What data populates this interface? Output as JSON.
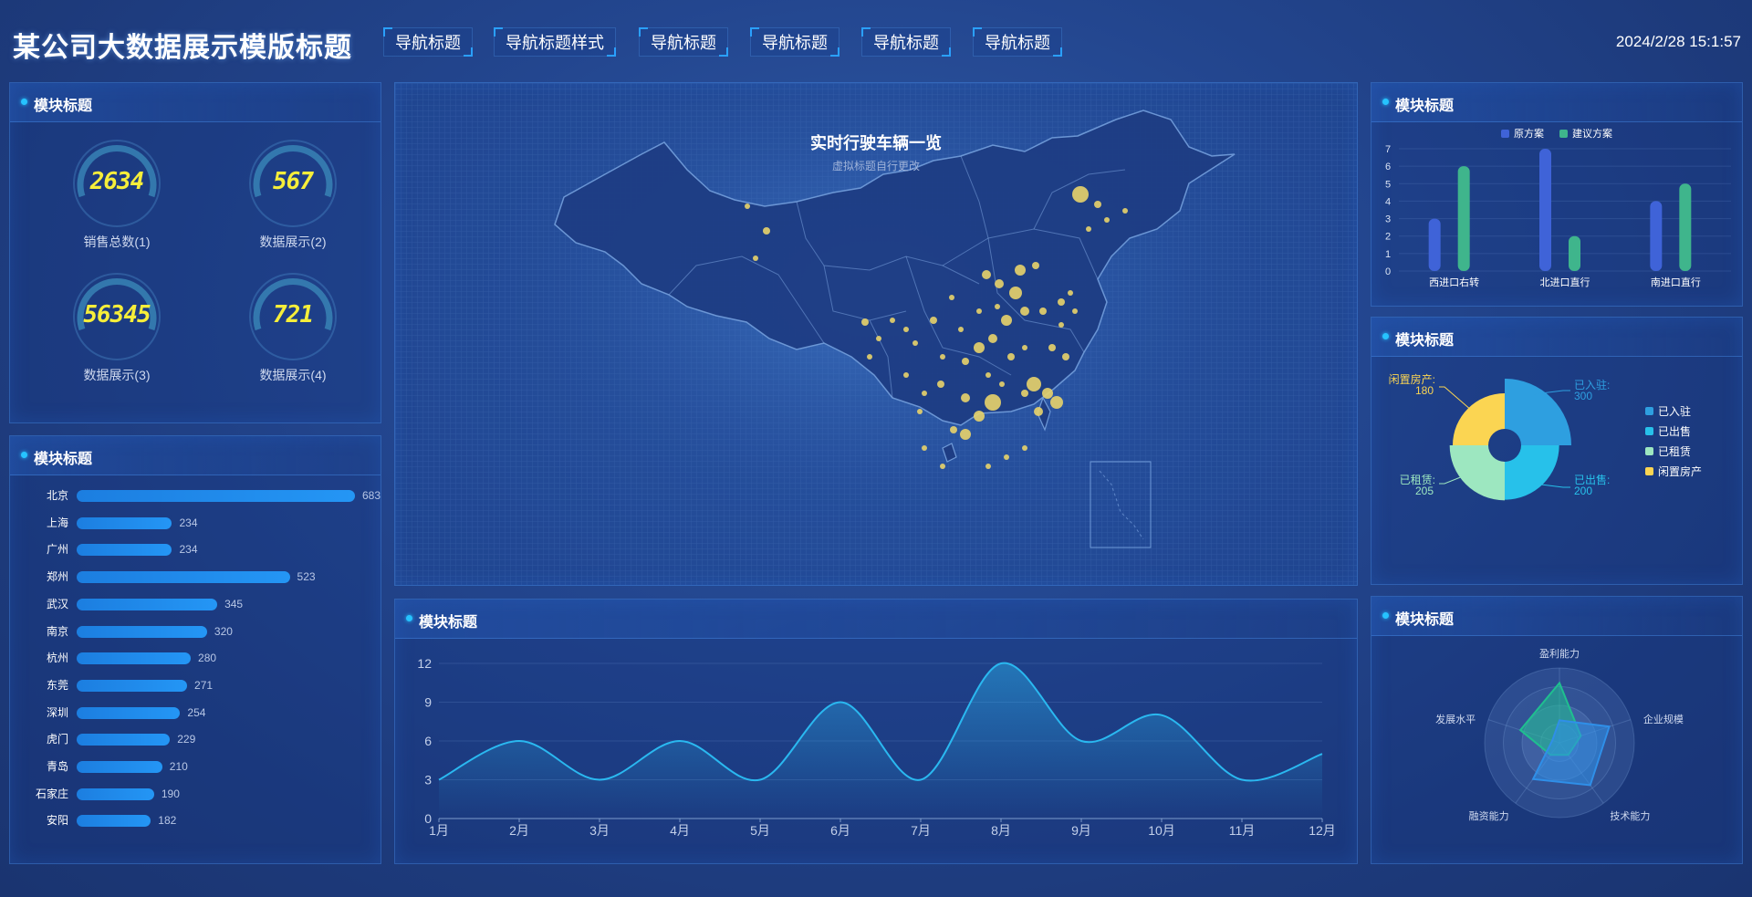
{
  "header": {
    "title": "某公司大数据展示模版标题",
    "nav": [
      "导航标题",
      "导航标题样式",
      "导航标题",
      "导航标题",
      "导航标题",
      "导航标题"
    ],
    "datetime": "2024/2/28 15:1:57"
  },
  "panels": {
    "gauges_title": "模块标题",
    "ranking_title": "模块标题",
    "linechart_title": "模块标题",
    "barchart_title": "模块标题",
    "donut_title": "模块标题",
    "radar_title": "模块标题"
  },
  "gauges": [
    {
      "value": "2634",
      "label": "销售总数(1)"
    },
    {
      "value": "567",
      "label": "数据展示(2)"
    },
    {
      "value": "56345",
      "label": "数据展示(3)"
    },
    {
      "value": "721",
      "label": "数据展示(4)"
    }
  ],
  "map": {
    "title": "实时行驶车辆一览",
    "subtitle": "虚拟标题自行更改"
  },
  "colors": {
    "accent": "#26c3ff",
    "bar_blue": "#1c8ae8",
    "gauge_digit": "#f6ee3a",
    "series_a": "#3f63d8",
    "series_b": "#3fb58c",
    "line": "#2ab8f0",
    "map_dot": "#e8d36a"
  },
  "chart_data": [
    {
      "type": "bar",
      "orientation": "horizontal",
      "categories": [
        "北京",
        "上海",
        "广州",
        "郑州",
        "武汉",
        "南京",
        "杭州",
        "东莞",
        "深圳",
        "虎门",
        "青岛",
        "石家庄",
        "安阳"
      ],
      "values": [
        683,
        234,
        234,
        523,
        345,
        320,
        280,
        271,
        254,
        229,
        210,
        190,
        182
      ]
    },
    {
      "type": "area",
      "categories": [
        "1月",
        "2月",
        "3月",
        "4月",
        "5月",
        "6月",
        "7月",
        "8月",
        "9月",
        "10月",
        "11月",
        "12月"
      ],
      "values": [
        3,
        6,
        3,
        6,
        3,
        9,
        3,
        12,
        6,
        8,
        3,
        5
      ],
      "ylim": [
        0,
        12
      ],
      "yticks": [
        0,
        3,
        6,
        9,
        12
      ]
    },
    {
      "type": "bar",
      "categories": [
        "西进口右转",
        "北进口直行",
        "南进口直行"
      ],
      "series": [
        {
          "name": "原方案",
          "values": [
            3,
            7,
            4
          ]
        },
        {
          "name": "建议方案",
          "values": [
            6,
            2,
            5
          ]
        }
      ],
      "ylim": [
        0,
        7
      ],
      "yticks": [
        0,
        1,
        2,
        3,
        4,
        5,
        6,
        7
      ],
      "legend": "top-center"
    },
    {
      "type": "pie",
      "style": "rose-donut",
      "slices": [
        {
          "name": "已入驻",
          "value": 300,
          "color": "#2e9fe0",
          "label": "已入驻:"
        },
        {
          "name": "已出售",
          "value": 200,
          "color": "#27c1ea",
          "label": "已出售:"
        },
        {
          "name": "已租赁",
          "value": 205,
          "color": "#9de7c0",
          "label": "已租赁:"
        },
        {
          "name": "闲置房产",
          "value": 180,
          "color": "#fbd552",
          "label": "闲置房产:"
        }
      ],
      "legend": "right"
    },
    {
      "type": "radar",
      "indicators": [
        "盈利能力",
        "企业规模",
        "技术能力",
        "融资能力",
        "发展水平"
      ],
      "max": 100,
      "series": [
        {
          "values": [
            80,
            30,
            20,
            20,
            55
          ],
          "color": "#1fbf8f"
        },
        {
          "values": [
            30,
            70,
            70,
            60,
            10
          ],
          "color": "#2f8fe8"
        }
      ]
    }
  ]
}
